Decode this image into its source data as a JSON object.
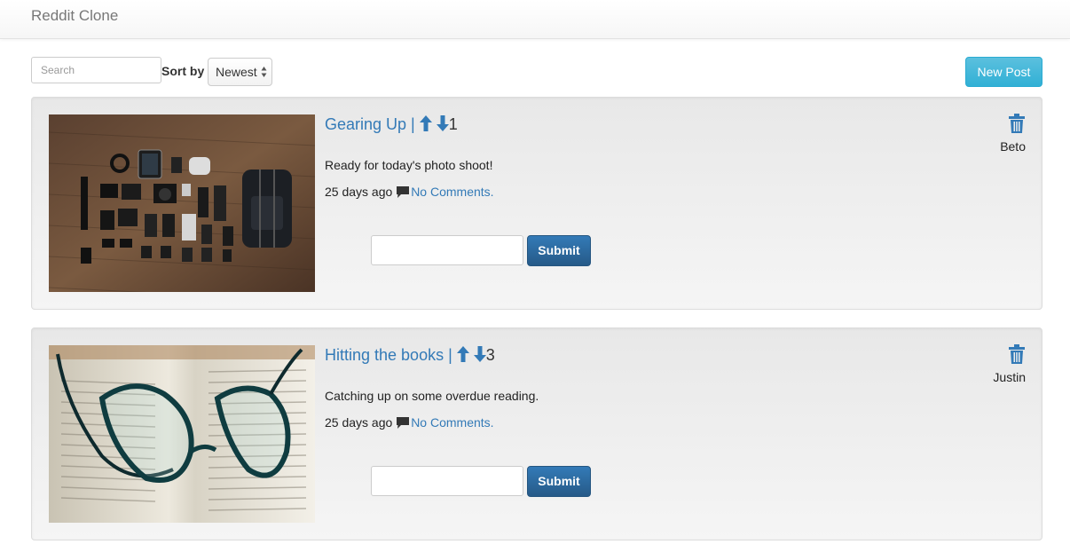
{
  "app": {
    "brand": "Reddit Clone"
  },
  "toolbar": {
    "search_placeholder": "Search",
    "sort_label": "Sort by",
    "sort_selected": "Newest",
    "new_post_label": "New Post"
  },
  "posts": [
    {
      "title": "Gearing Up |",
      "score": "1",
      "body": "Ready for today's photo shoot!",
      "age": "25 days ago",
      "comments_label": "No Comments.",
      "author": "Beto",
      "submit_label": "Submit",
      "image": "photography gear flat-lay on wooden floor"
    },
    {
      "title": "Hitting the books |",
      "score": "3",
      "body": "Catching up on some overdue reading.",
      "age": "25 days ago",
      "comments_label": "No Comments.",
      "author": "Justin",
      "submit_label": "Submit",
      "image": "eyeglasses resting on an open book"
    }
  ],
  "colors": {
    "link": "#337ab7",
    "info_button": "#5bc0de",
    "primary_button": "#286090",
    "card_bg": "#eeeeee"
  },
  "icons": [
    "upvote-arrow-icon",
    "downvote-arrow-icon",
    "comment-icon",
    "trash-icon",
    "select-arrows-icon"
  ]
}
